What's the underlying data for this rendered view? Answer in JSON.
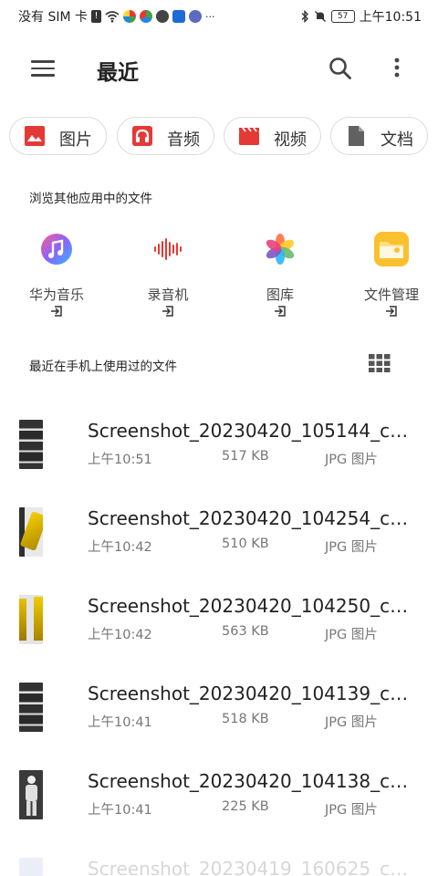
{
  "status_bar": {
    "carrier": "没有 SIM 卡",
    "battery": "57",
    "time": "上午10:51",
    "more_indicator": "···"
  },
  "header": {
    "title": "最近"
  },
  "chips": [
    {
      "label": "图片",
      "icon": "image-icon",
      "color": "#e53935"
    },
    {
      "label": "音频",
      "icon": "headphones-icon",
      "color": "#e53935"
    },
    {
      "label": "视频",
      "icon": "clapperboard-icon",
      "color": "#e53935"
    },
    {
      "label": "文档",
      "icon": "document-icon",
      "color": "#616161"
    }
  ],
  "browse_section": {
    "title": "浏览其他应用中的文件",
    "apps": [
      {
        "label": "华为音乐",
        "icon": "music-app-icon"
      },
      {
        "label": "录音机",
        "icon": "recorder-app-icon"
      },
      {
        "label": "图库",
        "icon": "gallery-app-icon"
      },
      {
        "label": "文件管理",
        "icon": "file-manager-app-icon"
      }
    ]
  },
  "recent_section": {
    "title": "最近在手机上使用过的文件"
  },
  "files": [
    {
      "name": "Screenshot_20230420_105144_co...",
      "time": "上午10:51",
      "size": "517 KB",
      "type": "JPG 图片"
    },
    {
      "name": "Screenshot_20230420_104254_co...",
      "time": "上午10:42",
      "size": "510 KB",
      "type": "JPG 图片"
    },
    {
      "name": "Screenshot_20230420_104250_co...",
      "time": "上午10:42",
      "size": "563 KB",
      "type": "JPG 图片"
    },
    {
      "name": "Screenshot_20230420_104139_co...",
      "time": "上午10:41",
      "size": "518 KB",
      "type": "JPG 图片"
    },
    {
      "name": "Screenshot_20230420_104138_co...",
      "time": "上午10:41",
      "size": "225 KB",
      "type": "JPG 图片"
    },
    {
      "name": "Screenshot_20230419_160625_co..."
    }
  ]
}
